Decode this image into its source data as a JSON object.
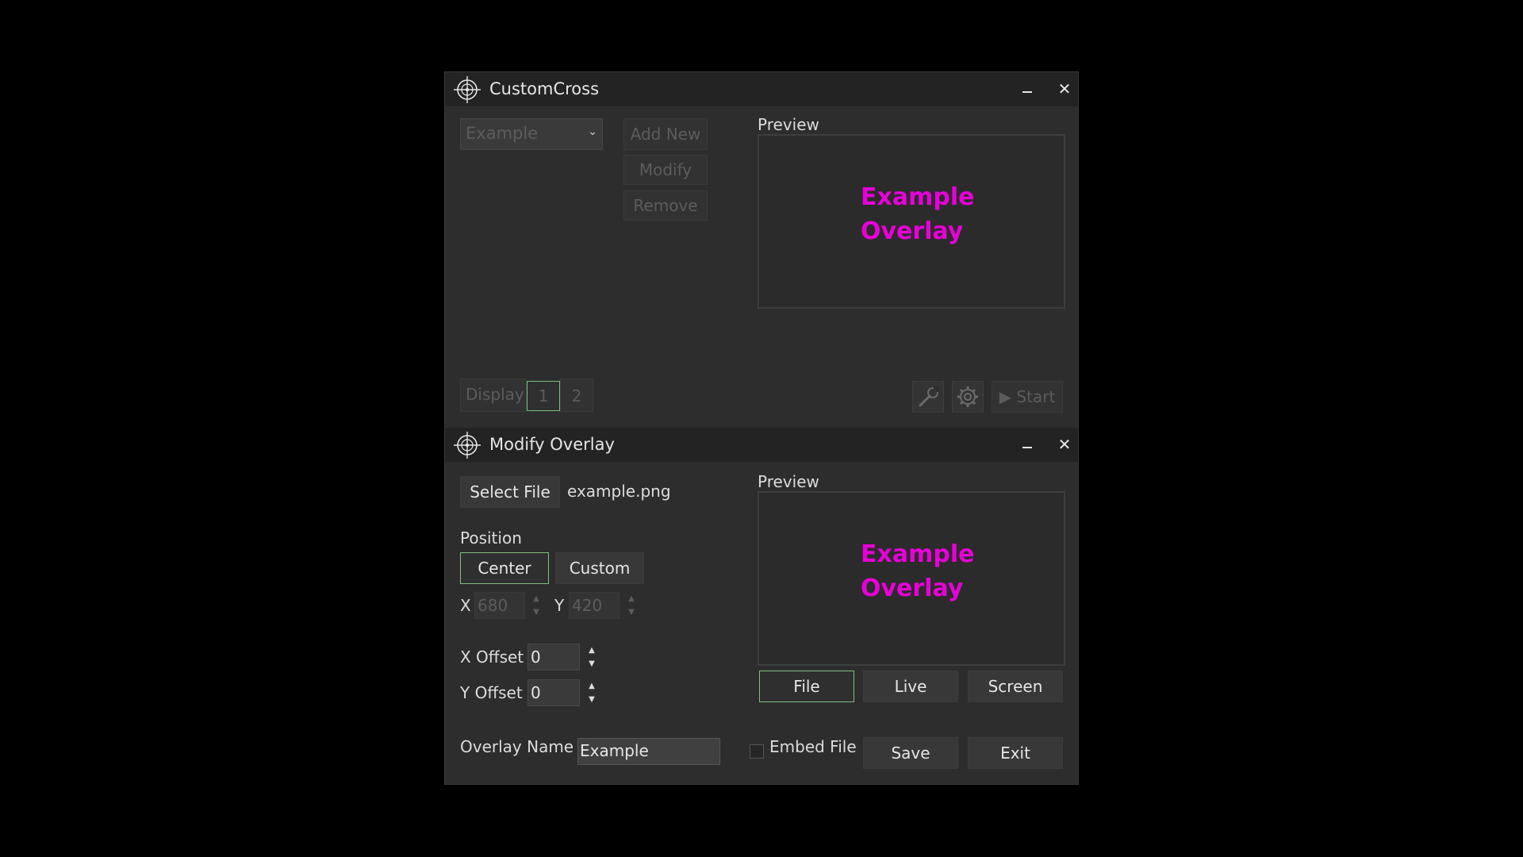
{
  "main_window": {
    "title": "CustomCross",
    "minimize_label": "",
    "close_label": "✕",
    "overlay_select": {
      "value": "Example"
    },
    "add_new_label": "Add New",
    "modify_label": "Modify",
    "remove_label": "Remove",
    "preview_label": "Preview",
    "preview_line1": "Example",
    "preview_line2": "Overlay",
    "display_label": "Display",
    "display_options": [
      "1",
      "2"
    ],
    "start_label": "▶ Start"
  },
  "modify_window": {
    "title": "Modify Overlay",
    "close_label": "✕",
    "select_file_label": "Select File",
    "file_name": "example.png",
    "position_label": "Position",
    "center_label": "Center",
    "custom_label": "Custom",
    "x_label": "X",
    "x_value": "680",
    "y_label": "Y",
    "y_value": "420",
    "x_offset_label": "X Offset",
    "x_offset_value": "0",
    "y_offset_label": "Y Offset",
    "y_offset_value": "0",
    "preview_label": "Preview",
    "preview_line1": "Example",
    "preview_line2": "Overlay",
    "file_tab_label": "File",
    "live_tab_label": "Live",
    "screen_tab_label": "Screen",
    "overlay_name_label": "Overlay Name",
    "overlay_name_value": "Example",
    "embed_file_label": "Embed File",
    "save_label": "Save",
    "exit_label": "Exit"
  },
  "colors": {
    "preview_text": "#e800d8",
    "active_border": "#7fbf7f",
    "window_bg": "#2d2d2d",
    "titlebar_bg": "#232323"
  }
}
